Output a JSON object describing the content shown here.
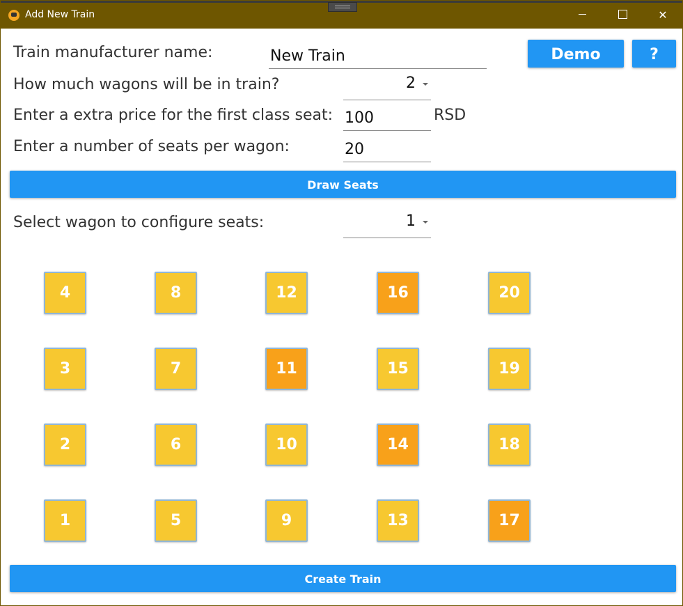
{
  "window": {
    "title": "Add New Train",
    "controls": {
      "minimize": "minimize-icon",
      "maximize": "maximize-icon",
      "close": "close-icon"
    }
  },
  "form": {
    "manufacturer_label": "Train manufacturer name:",
    "manufacturer_value": "New Train",
    "wagons_label": "How much wagons will be in train?",
    "wagons_value": "2",
    "first_class_label": "Enter a extra price for the first class seat:",
    "first_class_value": "100",
    "currency": "RSD",
    "seats_label": "Enter a number of seats per wagon:",
    "seats_value": "20"
  },
  "buttons": {
    "demo": "Demo",
    "help": "?",
    "draw_seats": "Draw Seats",
    "create_train": "Create Train"
  },
  "wagon_select": {
    "label": "Select wagon to configure seats:",
    "value": "1"
  },
  "seats": [
    [
      "4",
      "8",
      "12",
      "16",
      "20"
    ],
    [
      "3",
      "7",
      "11",
      "15",
      "19"
    ],
    [
      "2",
      "6",
      "10",
      "14",
      "18"
    ],
    [
      "1",
      "5",
      "9",
      "13",
      "17"
    ]
  ],
  "first_class_seats": [
    "16",
    "11",
    "14",
    "17"
  ],
  "colors": {
    "title_bar": "#6e5600",
    "accent_button": "#2196f3",
    "seat_standard": "#f7c830",
    "seat_first_class": "#f8a11a"
  }
}
